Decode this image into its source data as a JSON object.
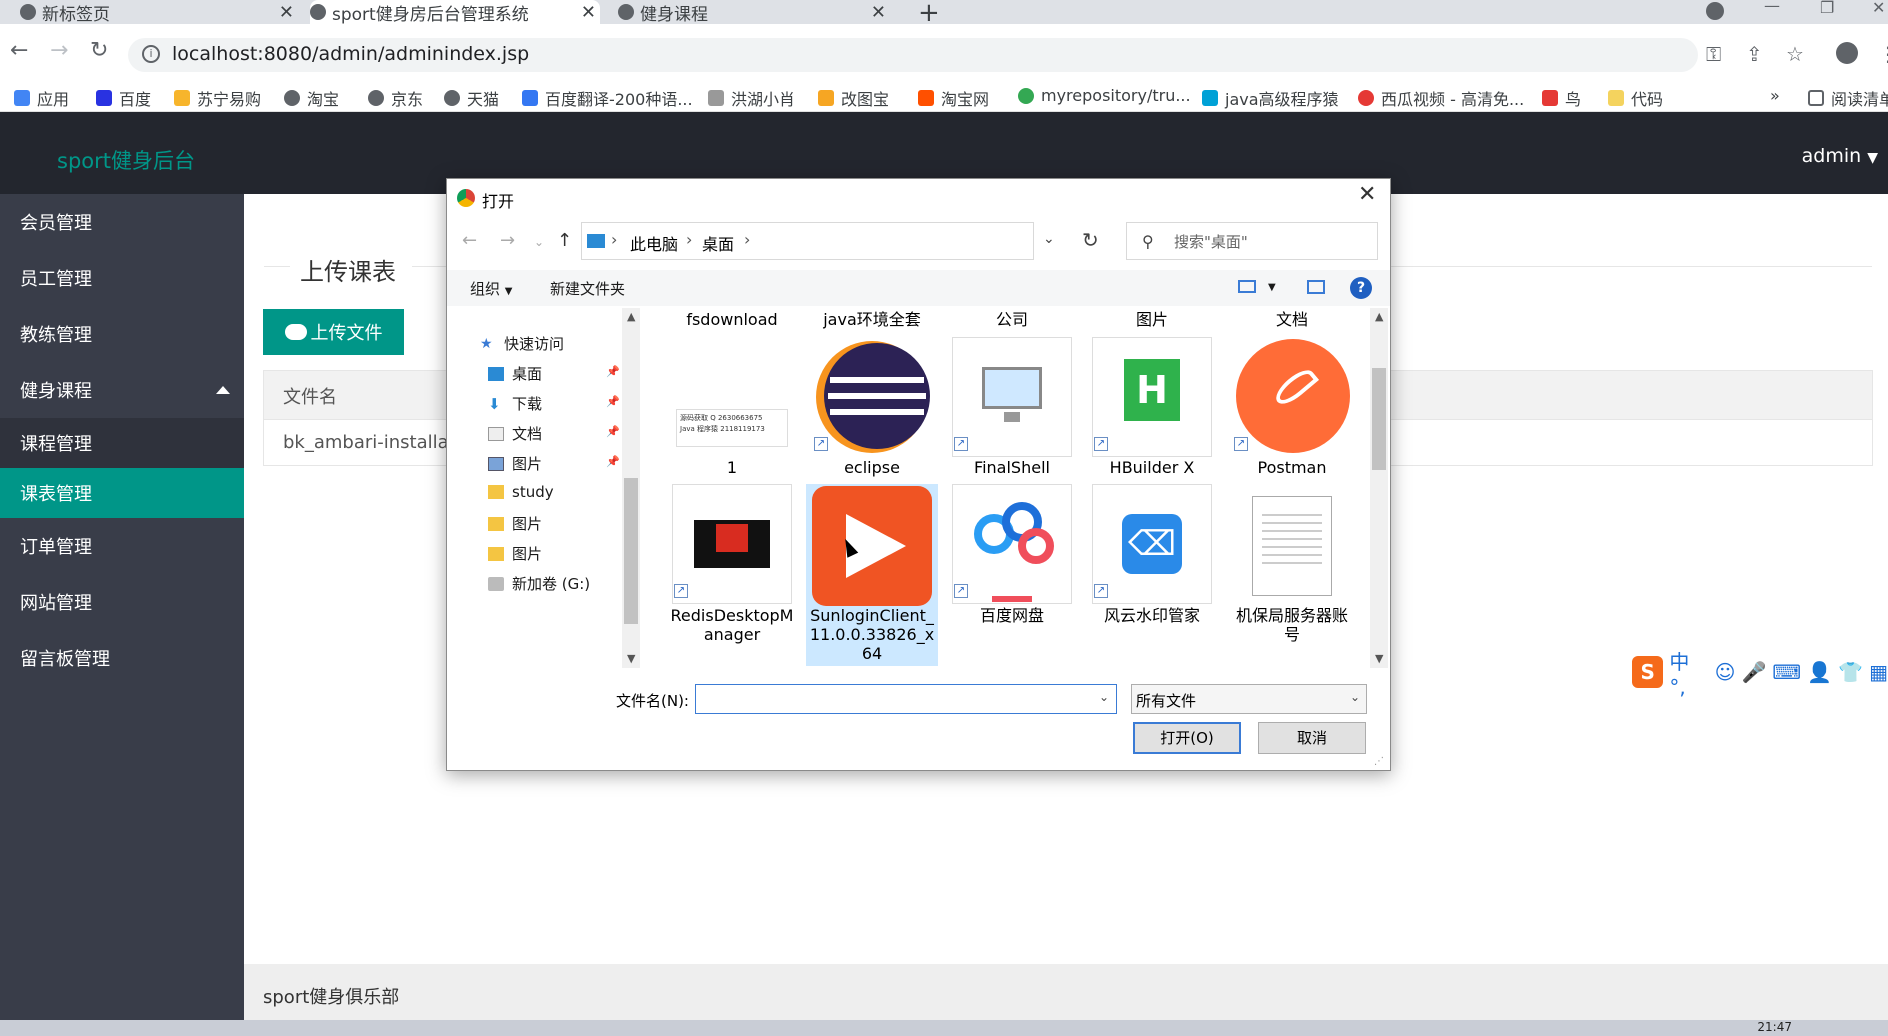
{
  "browser": {
    "tabs": [
      {
        "title": "新标签页"
      },
      {
        "title": "sport健身房后台管理系统"
      },
      {
        "title": "健身课程"
      }
    ],
    "url": "localhost:8080/admin/adminindex.jsp",
    "bookmarks": [
      {
        "label": "应用",
        "color": "#4285f4"
      },
      {
        "label": "百度",
        "color": "#2932e1"
      },
      {
        "label": "苏宁易购",
        "color": "#f7b52c"
      },
      {
        "label": "淘宝",
        "color": "#5f6368"
      },
      {
        "label": "京东",
        "color": "#5f6368"
      },
      {
        "label": "天猫",
        "color": "#5f6368"
      },
      {
        "label": "百度翻译-200种语...",
        "color": "#3477f2"
      },
      {
        "label": "洪湖小肖",
        "color": "#999999"
      },
      {
        "label": "改图宝",
        "color": "#f6a623"
      },
      {
        "label": "淘宝网",
        "color": "#ff5000"
      },
      {
        "label": "myrepository/tru...",
        "color": "#34a853"
      },
      {
        "label": "java高级程序猿",
        "color": "#00a1d6"
      },
      {
        "label": "西瓜视频 - 高清免...",
        "color": "#e53935"
      },
      {
        "label": "鸟",
        "color": "#e53935"
      },
      {
        "label": "代码",
        "color": "#f4d35e"
      },
      {
        "label": "阅读清单",
        "color": "#5f6368"
      }
    ]
  },
  "app": {
    "brand": "sport健身后台",
    "user": "admin",
    "sidebar": [
      {
        "label": "会员管理"
      },
      {
        "label": "员工管理"
      },
      {
        "label": "教练管理"
      },
      {
        "label": "健身课程"
      },
      {
        "label": "课程管理"
      },
      {
        "label": "课表管理"
      },
      {
        "label": "订单管理"
      },
      {
        "label": "网站管理"
      },
      {
        "label": "留言板管理"
      }
    ],
    "section_title": "上传课表",
    "upload_button": "上传文件",
    "table_header": "文件名",
    "table_rows": [
      {
        "name": "bk_ambari-installation"
      }
    ],
    "footer": "sport健身俱乐部"
  },
  "dialog": {
    "title": "打开",
    "path": [
      "此电脑",
      "桌面"
    ],
    "search_placeholder": "搜索\"桌面\"",
    "organize": "组织",
    "new_folder": "新建文件夹",
    "nav": [
      {
        "label": "快速访问",
        "pinned": false
      },
      {
        "label": "桌面",
        "pinned": true
      },
      {
        "label": "下载",
        "pinned": true
      },
      {
        "label": "文档",
        "pinned": true
      },
      {
        "label": "图片",
        "pinned": true
      },
      {
        "label": "study",
        "pinned": false
      },
      {
        "label": "图片",
        "pinned": false
      },
      {
        "label": "图片",
        "pinned": false
      },
      {
        "label": "新加卷 (G:)",
        "pinned": false
      }
    ],
    "top_labels": [
      "fsdownload",
      "java环境全套",
      "公司",
      "图片",
      "文档"
    ],
    "files_row1": [
      {
        "label": "1",
        "icon": "image-thumbnail-icon"
      },
      {
        "label": "eclipse",
        "icon": "eclipse-icon"
      },
      {
        "label": "FinalShell",
        "icon": "finalshell-icon"
      },
      {
        "label": "HBuilder X",
        "icon": "hbuilder-icon"
      },
      {
        "label": "Postman",
        "icon": "postman-icon"
      }
    ],
    "files_row2": [
      {
        "label": "RedisDesktopManager",
        "icon": "redis-icon"
      },
      {
        "label": "SunloginClient_11.0.0.33826_x64",
        "icon": "sunlogin-icon"
      },
      {
        "label": "百度网盘",
        "icon": "baidu-netdisk-icon"
      },
      {
        "label": "风云水印管家",
        "icon": "watermark-icon"
      },
      {
        "label": "机保局服务器账号",
        "icon": "text-file-icon"
      }
    ],
    "thumb_text_1": "源码获取 Q 2630663675",
    "thumb_text_2": "Java 程序猿 2118119173",
    "filename_label": "文件名(N):",
    "filename_value": "",
    "filetype": "所有文件",
    "open_button": "打开(O)",
    "cancel_button": "取消"
  },
  "ime": {
    "label": "中 °,"
  },
  "taskbar": {
    "time": "21:47"
  }
}
